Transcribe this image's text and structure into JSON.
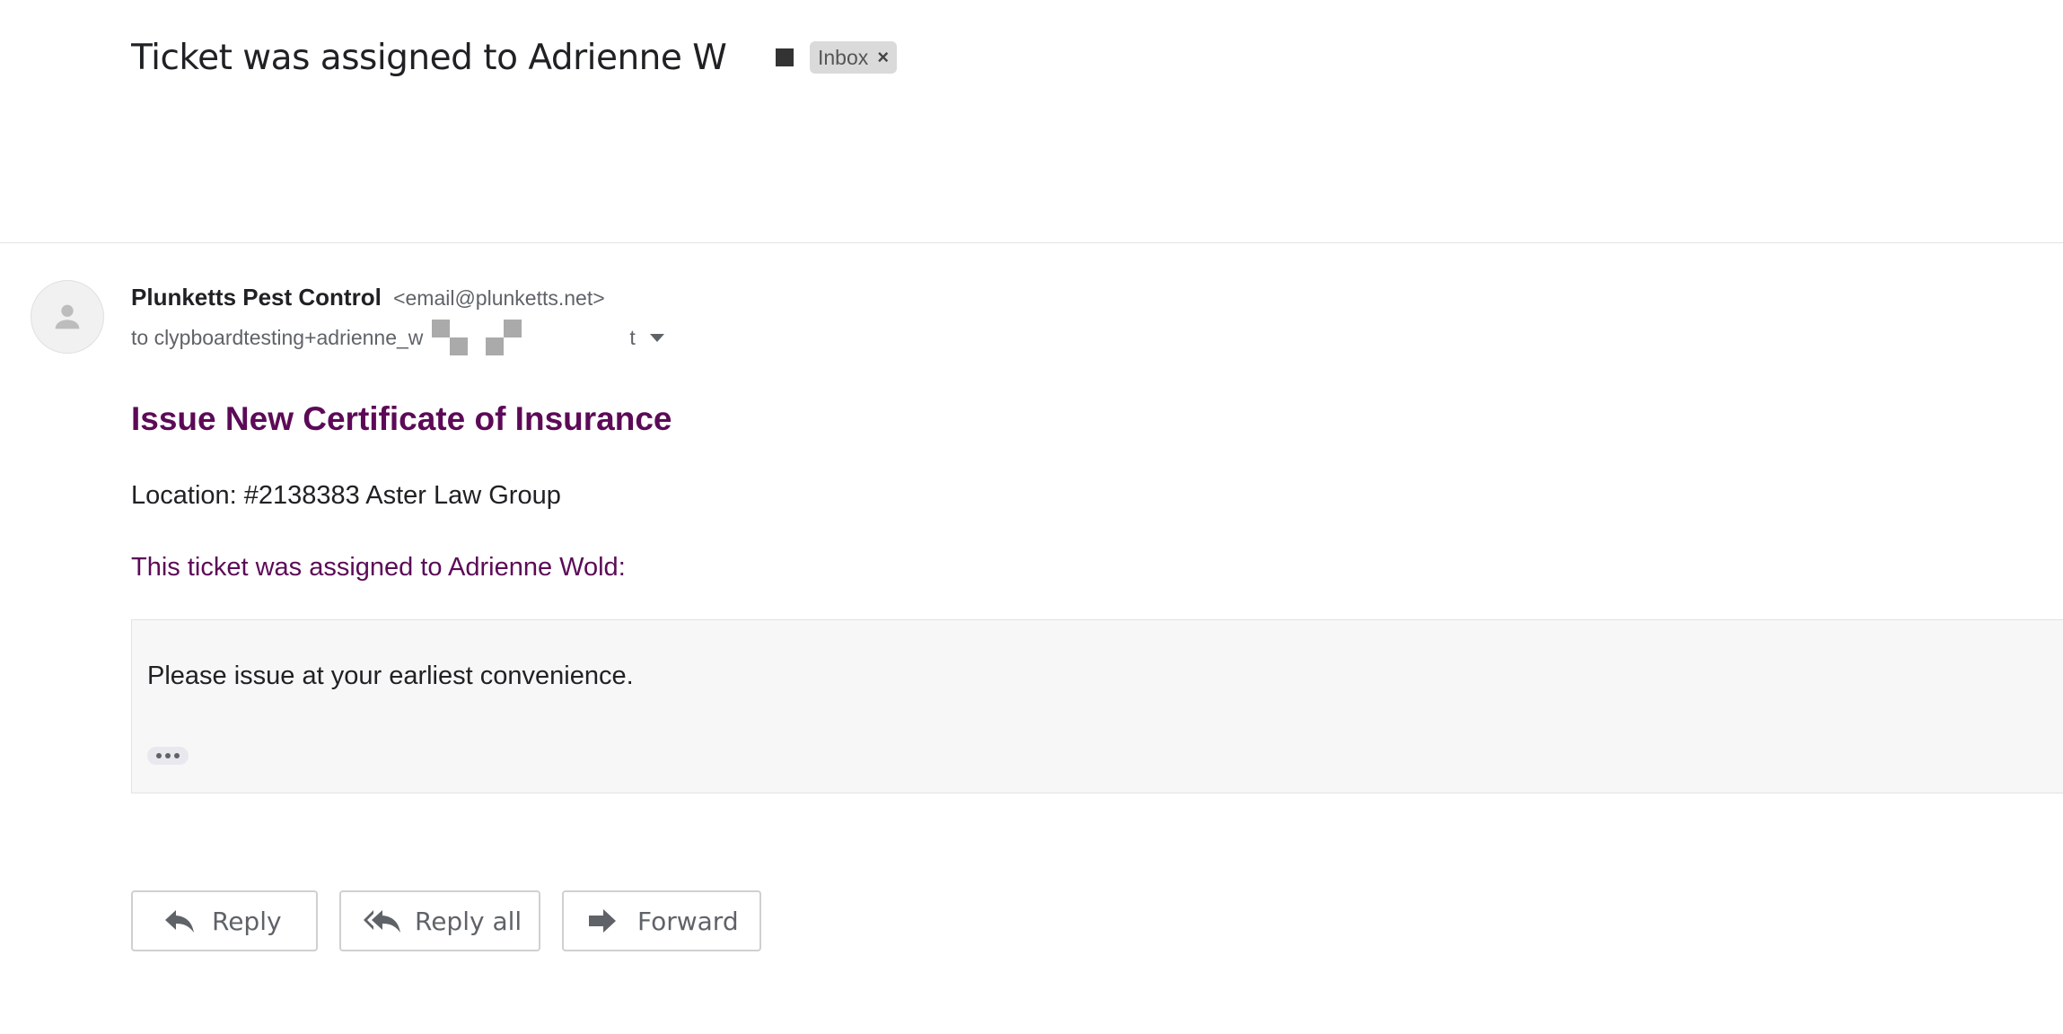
{
  "email": {
    "subject": "Ticket was assigned to Adrienne W",
    "label": "Inbox",
    "label_remove": "×",
    "sender_name": "Plunketts Pest Control",
    "sender_email": "<email@plunketts.net>",
    "to_prefix": "to clypboardtesting+adrienne_w",
    "to_suffix": "t"
  },
  "body": {
    "heading": "Issue New Certificate of Insurance",
    "location": "Location: #2138383 Aster Law Group",
    "assigned_line": "This ticket was assigned to Adrienne Wold:",
    "quote": "Please issue at your earliest convenience."
  },
  "actions": {
    "reply": "Reply",
    "reply_all": "Reply all",
    "forward": "Forward"
  },
  "colors": {
    "accent_purple": "#5c0a57",
    "text": "#202124",
    "muted": "#5f6368"
  },
  "icons": [
    "person-icon",
    "chevron-down-icon",
    "reply-icon",
    "reply-all-icon",
    "forward-icon",
    "more-icon"
  ]
}
